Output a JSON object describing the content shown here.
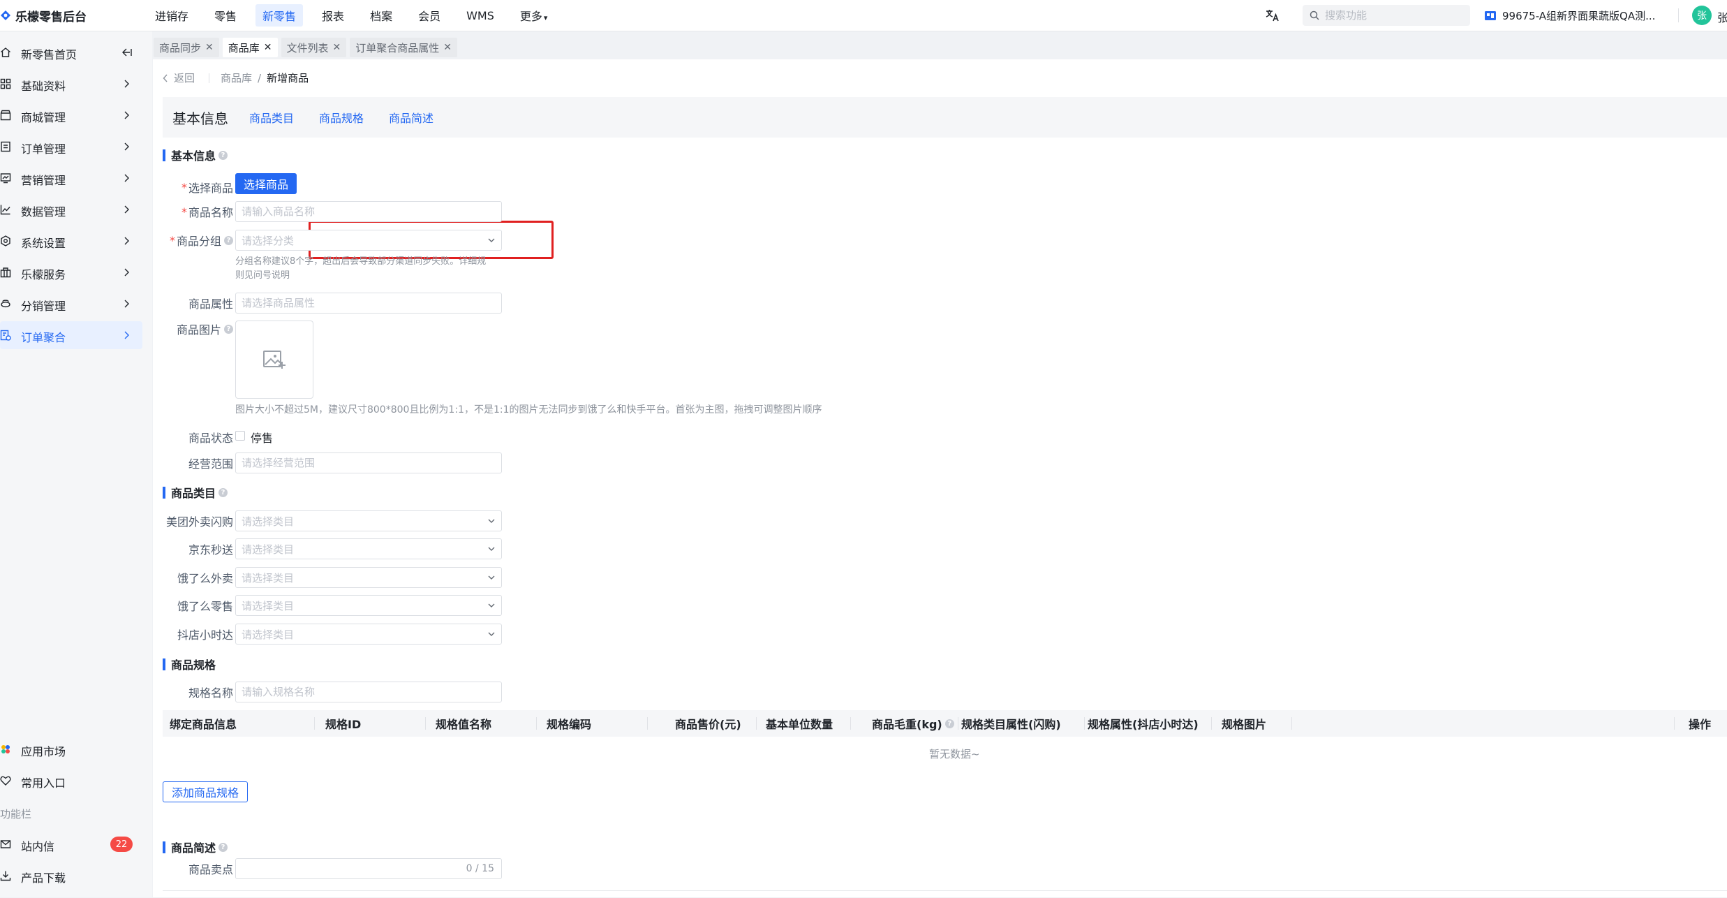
{
  "app": {
    "logo_text": "乐檬零售后台"
  },
  "topnav": {
    "items": [
      "进销存",
      "零售",
      "新零售",
      "报表",
      "档案",
      "会员",
      "WMS",
      "更多"
    ],
    "active": "新零售"
  },
  "search": {
    "placeholder": "搜索功能"
  },
  "store_name": "99675-A组新界面果蔬版QA测...",
  "user": {
    "avatar_text": "张",
    "name": "张"
  },
  "sidebar": {
    "items": [
      {
        "label": "新零售首页",
        "icon": "home-icon"
      },
      {
        "label": "基础资料",
        "icon": "grid-icon"
      },
      {
        "label": "商城管理",
        "icon": "shop-icon"
      },
      {
        "label": "订单管理",
        "icon": "order-icon"
      },
      {
        "label": "营销管理",
        "icon": "marketing-icon"
      },
      {
        "label": "数据管理",
        "icon": "chart-icon"
      },
      {
        "label": "系统设置",
        "icon": "settings-icon"
      },
      {
        "label": "乐檬服务",
        "icon": "service-icon"
      },
      {
        "label": "分销管理",
        "icon": "distribution-icon"
      },
      {
        "label": "订单聚合",
        "icon": "aggregate-icon"
      }
    ],
    "active": "订单聚合",
    "bottom_items": [
      {
        "label": "应用市场",
        "icon": "app-market-icon"
      },
      {
        "label": "常用入口",
        "icon": "heart-icon"
      }
    ],
    "section_label": "功能栏",
    "func_items": [
      {
        "label": "站内信",
        "icon": "mail-icon",
        "badge": "22"
      },
      {
        "label": "产品下载",
        "icon": "download-icon"
      }
    ]
  },
  "tabs": [
    {
      "label": "商品同步",
      "active": false
    },
    {
      "label": "商品库",
      "active": true
    },
    {
      "label": "文件列表",
      "active": false
    },
    {
      "label": "订单聚合商品属性",
      "active": false
    }
  ],
  "breadcrumb": {
    "back": "返回",
    "parent": "商品库",
    "separator": "/",
    "current": "新增商品"
  },
  "anchor": {
    "title": "基本信息",
    "links": [
      "商品类目",
      "商品规格",
      "商品简述"
    ]
  },
  "basic": {
    "title": "基本信息",
    "select_goods_label": "选择商品",
    "select_goods_button": "选择商品",
    "name_label": "商品名称",
    "name_placeholder": "请输入商品名称",
    "group_label": "商品分组",
    "group_placeholder": "请选择分类",
    "group_hint_line1": "分组名称建议8个字，超出后会导致部分渠道同步失败。详细规",
    "group_hint_line2": "则见问号说明",
    "attr_label": "商品属性",
    "attr_placeholder": "请选择商品属性",
    "image_label": "商品图片",
    "image_hint": "图片大小不超过5M，建议尺寸800*800且比例为1:1，不是1:1的图片无法同步到饿了么和快手平台。首张为主图，拖拽可调整图片顺序",
    "status_label": "商品状态",
    "status_option": "停售",
    "scope_label": "经营范围",
    "scope_placeholder": "请选择经营范围"
  },
  "category": {
    "title": "商品类目",
    "rows": [
      {
        "label": "美团外卖闪购",
        "placeholder": "请选择类目"
      },
      {
        "label": "京东秒送",
        "placeholder": "请选择类目"
      },
      {
        "label": "饿了么外卖",
        "placeholder": "请选择类目"
      },
      {
        "label": "饿了么零售",
        "placeholder": "请选择类目"
      },
      {
        "label": "抖店小时达",
        "placeholder": "请选择类目"
      }
    ]
  },
  "spec": {
    "title": "商品规格",
    "name_label": "规格名称",
    "name_placeholder": "请输入规格名称",
    "columns": [
      "绑定商品信息",
      "规格ID",
      "规格值名称",
      "规格编码",
      "商品售价(元)",
      "基本单位数量",
      "商品毛重(kg)",
      "规格类目属性(闪购)",
      "规格属性(抖店小时达)",
      "规格图片",
      "操作"
    ],
    "empty_text": "暂无数据~",
    "add_button": "添加商品规格"
  },
  "desc": {
    "title": "商品简述",
    "selling_label": "商品卖点",
    "counter": "0 / 15"
  },
  "colors": {
    "primary": "#2468f2",
    "danger": "#f54a45",
    "highlight_border": "#e02020"
  }
}
